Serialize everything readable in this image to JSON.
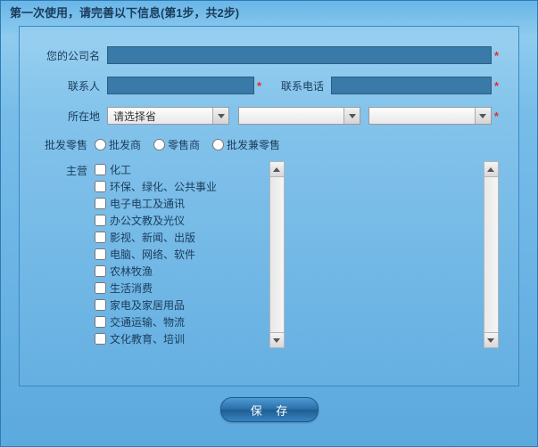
{
  "title": "第一次使用，请完善以下信息(第1步，共2步)",
  "labels": {
    "company": "您的公司名",
    "contact": "联系人",
    "phone": "联系电话",
    "location": "所在地",
    "businessType": "批发零售",
    "mainBusiness": "主营"
  },
  "values": {
    "company": "",
    "contact": "",
    "phone": ""
  },
  "selects": {
    "province": {
      "selected": "请选择省"
    },
    "city": {
      "selected": ""
    },
    "district": {
      "selected": ""
    }
  },
  "businessTypes": [
    "批发商",
    "零售商",
    "批发兼零售"
  ],
  "mainBusinessOptions": [
    "化工",
    "环保、绿化、公共事业",
    "电子电工及通讯",
    "办公文教及光仪",
    "影视、新闻、出版",
    "电脑、网络、软件",
    "农林牧渔",
    "生活消费",
    "家电及家居用品",
    "交通运输、物流",
    "文化教育、培训"
  ],
  "buttons": {
    "save": "保 存"
  }
}
